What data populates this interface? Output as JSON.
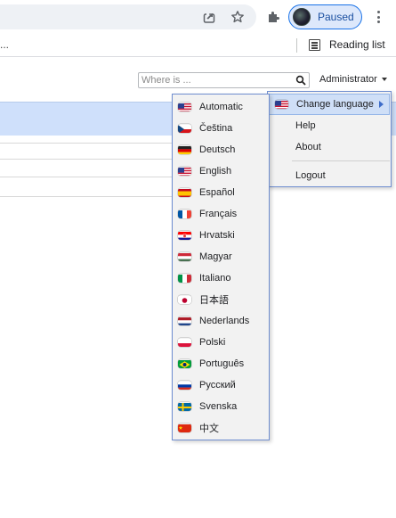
{
  "toolbar": {
    "share_icon": "share-icon",
    "star_icon": "star-icon",
    "extensions_icon": "puzzle-icon",
    "profile_label": "Paused",
    "menu_icon": "kebab-icon"
  },
  "bookmarks": {
    "overflow": "...",
    "reading_list_label": "Reading list"
  },
  "header": {
    "search_placeholder": "Where is ...",
    "search_value": "",
    "user_menu_label": "Administrator"
  },
  "colors": {
    "accent": "#1a73e8",
    "band": "#cfe0fb",
    "menu_border": "#6f8ed0",
    "highlight": "#cfdff7"
  },
  "main_menu": {
    "items": [
      {
        "label": "Change language",
        "flag": "us",
        "has_submenu": true
      },
      {
        "label": "Help"
      },
      {
        "label": "About"
      },
      {
        "label": "Logout"
      }
    ]
  },
  "language_menu": {
    "items": [
      {
        "label": "Automatic",
        "flag": "us"
      },
      {
        "label": "Čeština",
        "flag": "cz"
      },
      {
        "label": "Deutsch",
        "flag": "de"
      },
      {
        "label": "English",
        "flag": "us"
      },
      {
        "label": "Español",
        "flag": "es"
      },
      {
        "label": "Français",
        "flag": "fr"
      },
      {
        "label": "Hrvatski",
        "flag": "hr"
      },
      {
        "label": "Magyar",
        "flag": "hu"
      },
      {
        "label": "Italiano",
        "flag": "it"
      },
      {
        "label": "日本語",
        "flag": "jp"
      },
      {
        "label": "Nederlands",
        "flag": "nl"
      },
      {
        "label": "Polski",
        "flag": "pl"
      },
      {
        "label": "Português",
        "flag": "br"
      },
      {
        "label": "Русский",
        "flag": "ru"
      },
      {
        "label": "Svenska",
        "flag": "se"
      },
      {
        "label": "中文",
        "flag": "cn"
      }
    ]
  }
}
